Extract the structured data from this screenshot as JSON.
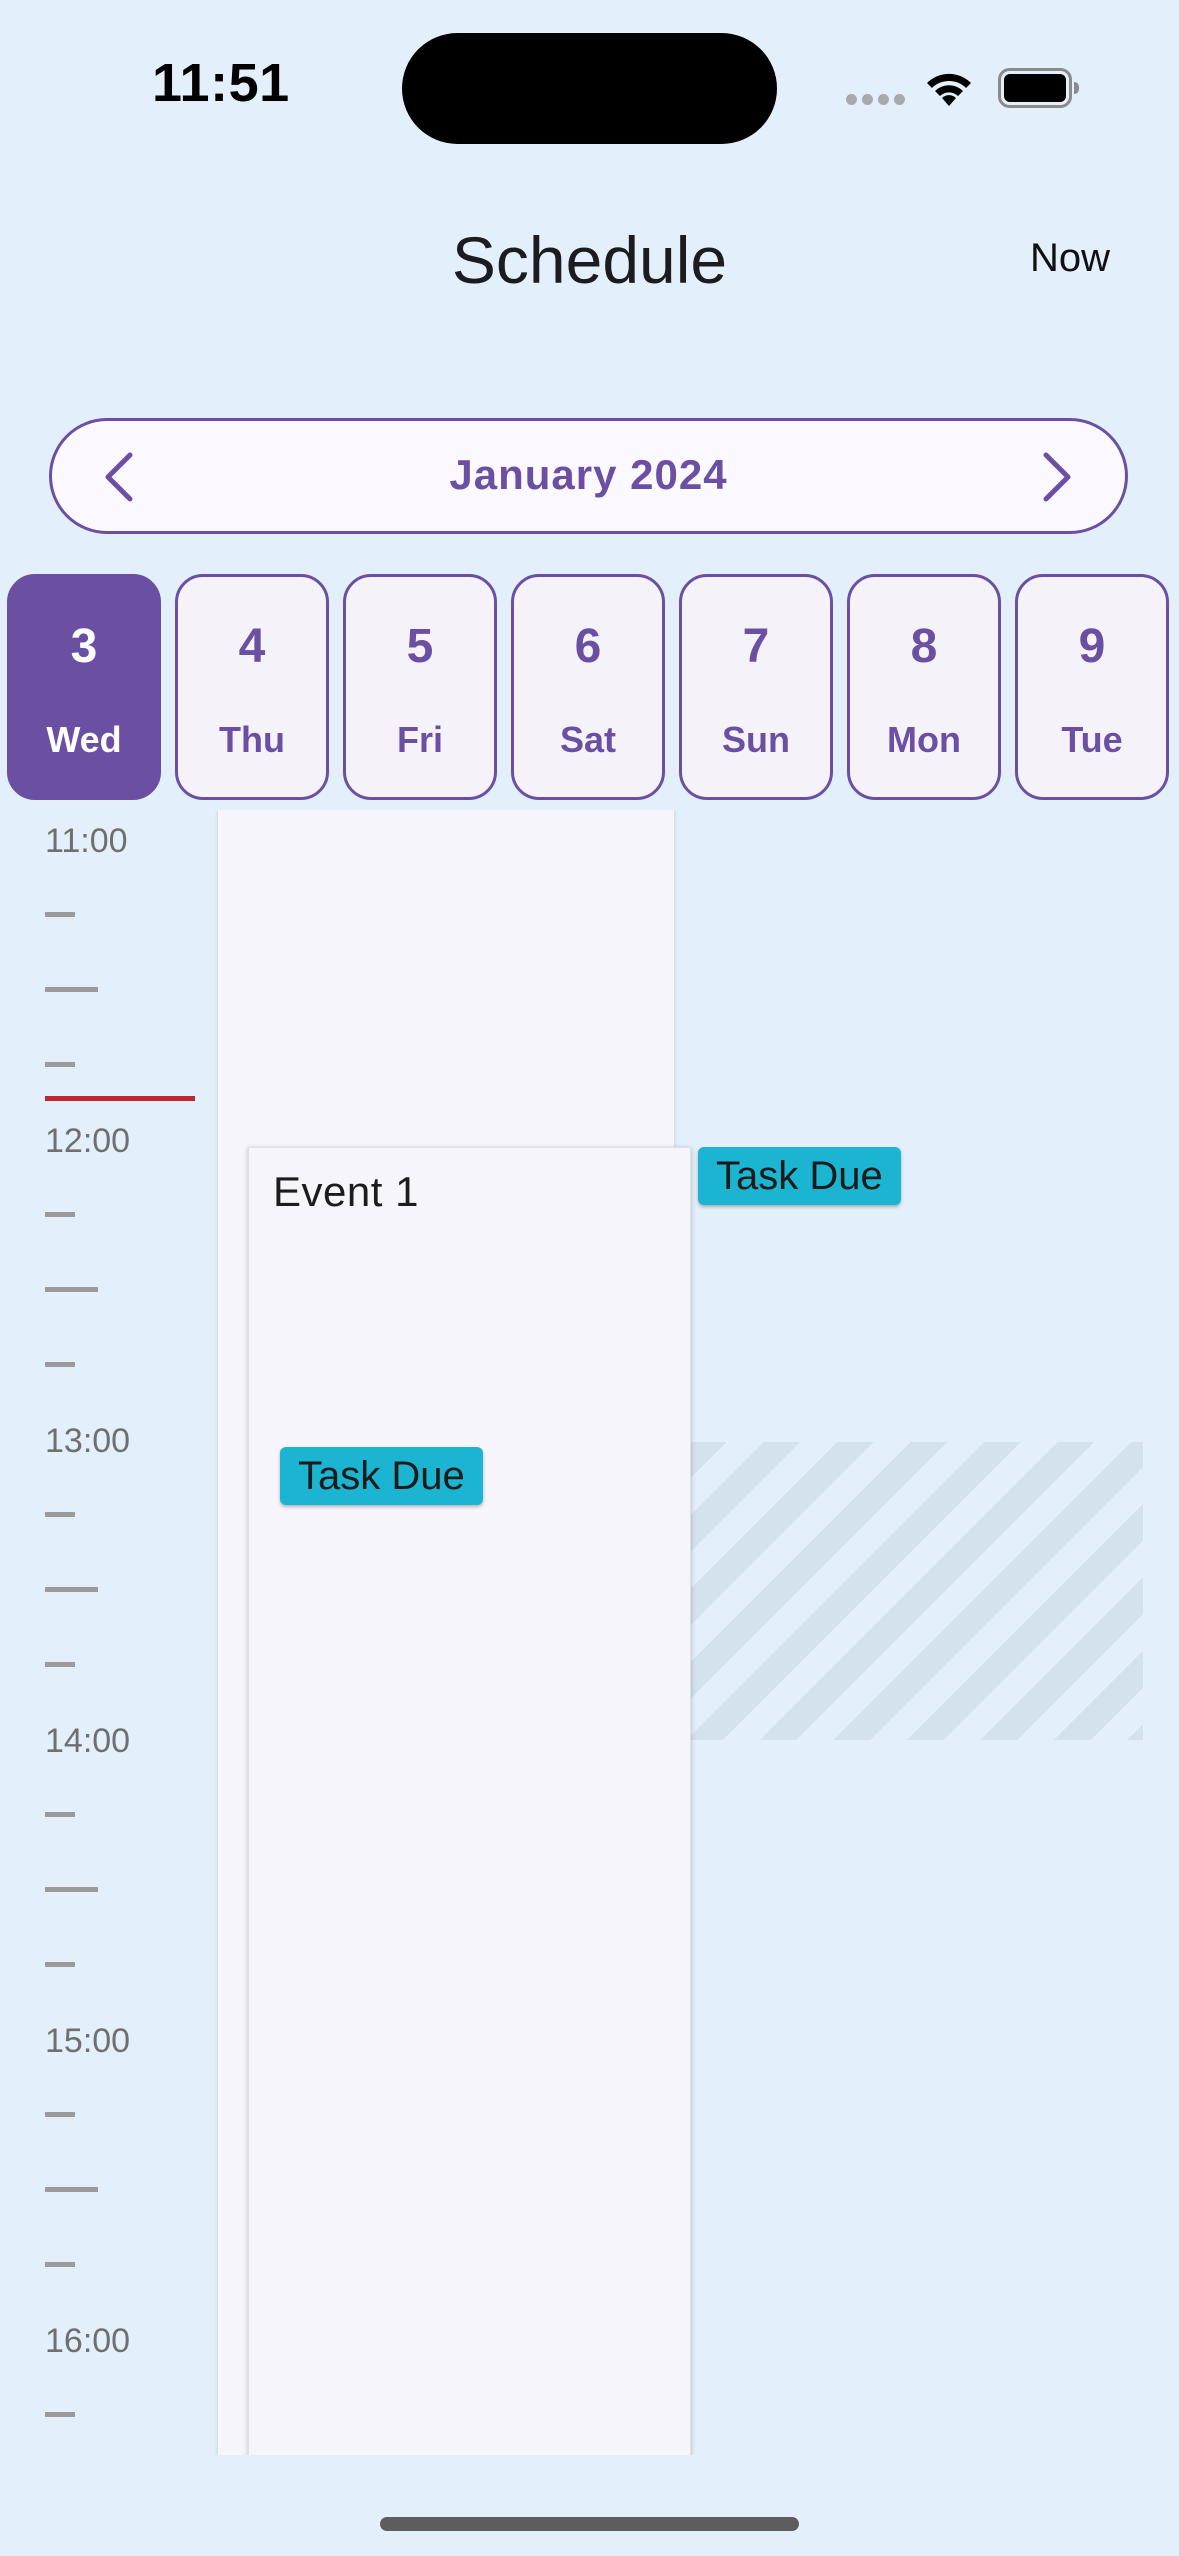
{
  "status_bar": {
    "time": "11:51",
    "icons": [
      "cellular-signal-icon",
      "wifi-icon",
      "battery-icon"
    ]
  },
  "header": {
    "title": "Schedule",
    "now_label": "Now"
  },
  "month_selector": {
    "label": "January 2024",
    "prev_icon": "chevron-left-icon",
    "next_icon": "chevron-right-icon"
  },
  "days": [
    {
      "num": "3",
      "name": "Wed",
      "selected": true
    },
    {
      "num": "4",
      "name": "Thu",
      "selected": false
    },
    {
      "num": "5",
      "name": "Fri",
      "selected": false
    },
    {
      "num": "6",
      "name": "Sat",
      "selected": false
    },
    {
      "num": "7",
      "name": "Sun",
      "selected": false
    },
    {
      "num": "8",
      "name": "Mon",
      "selected": false
    },
    {
      "num": "9",
      "name": "Tue",
      "selected": false
    }
  ],
  "timeline": {
    "hours": [
      "11:00",
      "12:00",
      "13:00",
      "14:00",
      "15:00",
      "16:00"
    ]
  },
  "event": {
    "title": "Event 1"
  },
  "tasks": [
    {
      "label": "Task Due"
    },
    {
      "label": "Task Due"
    }
  ],
  "colors": {
    "background": "#e3f0fb",
    "accent": "#6a4fa3",
    "task_chip": "#1bb5d1",
    "now_line": "#c0262d"
  }
}
